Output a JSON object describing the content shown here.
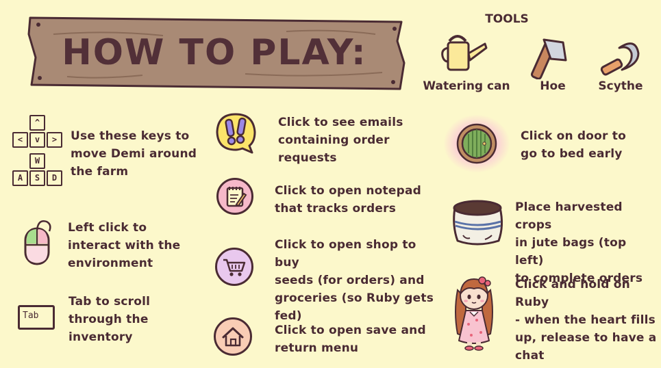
{
  "sign": {
    "title": "HOW TO PLAY:"
  },
  "tools": {
    "title": "TOOLS",
    "items": [
      {
        "label": "Watering can",
        "icon": "watering-can-icon"
      },
      {
        "label": "Hoe",
        "icon": "hoe-icon"
      },
      {
        "label": "Scythe",
        "icon": "scythe-icon"
      }
    ]
  },
  "controls": {
    "keys": {
      "arrows": [
        "^",
        "<",
        "v",
        ">"
      ],
      "wasd": [
        "W",
        "A",
        "S",
        "D"
      ],
      "text": [
        "Use these keys to",
        "move Demi around",
        "the farm"
      ]
    },
    "mouse": {
      "text": [
        "Left click to",
        "interact with the",
        "environment"
      ]
    },
    "tab": {
      "key_label": "Tab",
      "text": [
        "Tab to scroll",
        "through the",
        "inventory"
      ]
    }
  },
  "buttons": {
    "email": {
      "text": [
        "Click to see emails",
        "containing order",
        "requests"
      ]
    },
    "notepad": {
      "text": [
        "Click to open notepad",
        "that tracks orders"
      ]
    },
    "shop": {
      "text": [
        "Click to open shop to buy",
        "seeds (for orders) and",
        "groceries (so Ruby gets",
        "fed)"
      ]
    },
    "home": {
      "text": [
        "Click to open save and",
        "return menu"
      ]
    }
  },
  "right": {
    "door": {
      "text": [
        "Click on door to",
        "go to bed early"
      ]
    },
    "bag": {
      "text": [
        "Place harvested crops",
        "in jute bags (top left)",
        "to complete orders"
      ]
    },
    "ruby": {
      "text": [
        "Click and hold on Ruby",
        "- when the heart fills",
        "up, release to have a",
        "chat"
      ]
    }
  },
  "colors": {
    "background": "#fcf8cb",
    "text": "#4a2b33",
    "wood": "#a98a75",
    "email_bg": "#fbe46a",
    "notepad_bg": "#f6b9c9",
    "shop_bg": "#e9c8ee",
    "home_bg": "#f9cdb5"
  }
}
